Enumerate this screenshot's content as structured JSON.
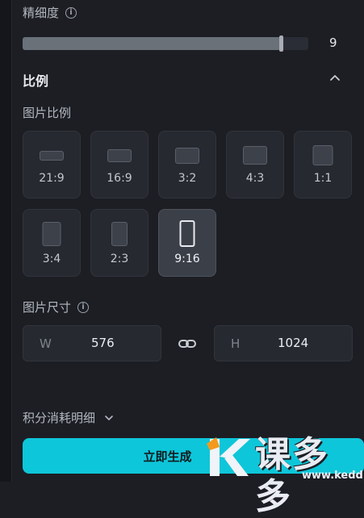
{
  "fineness": {
    "label": "精细度",
    "value": "9",
    "fraction": 0.905
  },
  "ratio_section": {
    "title": "比例"
  },
  "image_ratio": {
    "label": "图片比例",
    "options": [
      {
        "label": "21:9"
      },
      {
        "label": "16:9"
      },
      {
        "label": "3:2"
      },
      {
        "label": "4:3"
      },
      {
        "label": "1:1"
      },
      {
        "label": "3:4"
      },
      {
        "label": "2:3"
      },
      {
        "label": "9:16",
        "selected": true
      }
    ]
  },
  "image_size": {
    "label": "图片尺寸",
    "width_prefix": "W",
    "width": "576",
    "height_prefix": "H",
    "height": "1024"
  },
  "cost": {
    "label": "积分消耗明细"
  },
  "generate": {
    "label": "立即生成"
  },
  "watermark": {
    "text": "课多多",
    "url": "www.kedd.c"
  },
  "colors": {
    "accent": "#0ec6d9",
    "background": "#1c1e24",
    "tile": "#262930",
    "tile_selected": "#3b3f48"
  }
}
